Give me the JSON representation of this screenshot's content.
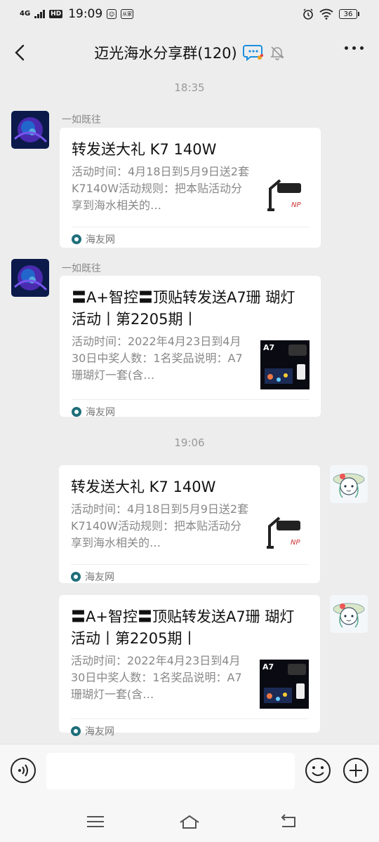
{
  "status_bar": {
    "signal_label": "4G",
    "hd_label": "HD",
    "time": "19:09",
    "small_icon_label": "从家",
    "battery": "36"
  },
  "header": {
    "title": "迈光海水分享群(120)"
  },
  "timestamps": [
    "18:35",
    "19:06"
  ],
  "messages": [
    {
      "sender": "一如既往",
      "title": "转发送大礼 K7 140W",
      "desc": "活动时间：4月18日到5月9日送2套K7140W活动规则：把本贴活动分享到海水相关的…",
      "source": "海友网"
    },
    {
      "sender": "一如既往",
      "title": "〓A+智控〓顶贴转发送A7珊 瑚灯活动丨第2205期丨",
      "desc": "活动时间：2022年4月23日到4月30日中奖人数：1名奖品说明：A7珊瑚灯一套(含…",
      "source": "海友网"
    },
    {
      "title": "转发送大礼 K7 140W",
      "desc": "活动时间：4月18日到5月9日送2套K7140W活动规则：把本贴活动分享到海水相关的…",
      "source": "海友网"
    },
    {
      "title": "〓A+智控〓顶贴转发送A7珊 瑚灯活动丨第2205期丨",
      "desc": "活动时间：2022年4月23日到4月30日中奖人数：1名奖品说明：A7珊瑚灯一套(含…",
      "source": "海友网"
    }
  ],
  "thumb_labels": {
    "k7_logo": "NP",
    "a7_label": "A7"
  },
  "colors": {
    "background": "#ededed",
    "card": "#ffffff",
    "accent_teal": "#1e6e7a"
  }
}
